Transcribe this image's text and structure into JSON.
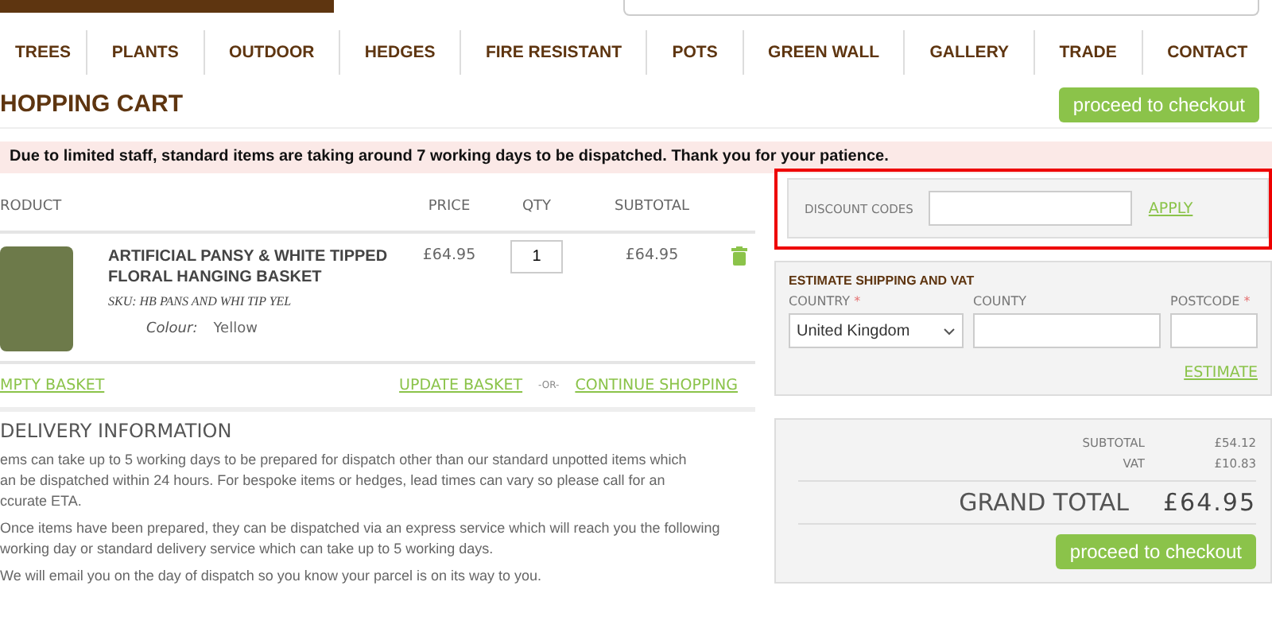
{
  "nav": [
    "TREES",
    "PLANTS",
    "OUTDOOR",
    "HEDGES",
    "FIRE RESISTANT",
    "POTS",
    "GREEN WALL",
    "GALLERY",
    "TRADE",
    "CONTACT"
  ],
  "title": "HOPPING CART",
  "checkout_top": "proceed to checkout",
  "notice": "Due to limited staff, standard items are taking around 7 working days to be dispatched. Thank you for your patience.",
  "cart": {
    "columns": [
      "RODUCT",
      "PRICE",
      "QTY",
      "SUBTOTAL"
    ],
    "items": [
      {
        "name": "ARTIFICIAL PANSY & WHITE TIPPED FLORAL HANGING BASKET",
        "sku": "SKU: HB PANS AND WHI TIP YEL",
        "option_label": "Colour:",
        "option_value": "Yellow",
        "price": "£64.95",
        "qty": "1",
        "subtotal": "£64.95"
      }
    ],
    "empty": "MPTY BASKET",
    "update": "UPDATE BASKET",
    "or": "-OR-",
    "continue": "CONTINUE SHOPPING"
  },
  "delivery": {
    "title": "DELIVERY INFORMATION",
    "paragraphs": [
      [
        "ems can take up to 5 working days to be prepared for dispatch other than our standard unpotted items which",
        "an be dispatched within 24 hours. For bespoke items or hedges, lead times can vary so please call for an",
        "ccurate ETA."
      ],
      [
        "Once items have been prepared, they can be dispatched via an express service which will reach you the following",
        "working day or standard delivery service which can take up to 5 working days."
      ],
      [
        "We will email you on the day of dispatch so you know your parcel is on its way to you."
      ]
    ]
  },
  "discount": {
    "label": "DISCOUNT CODES",
    "apply": "APPLY"
  },
  "shipping": {
    "title": "ESTIMATE SHIPPING AND VAT",
    "fields": [
      {
        "label": "COUNTRY",
        "marker": "*",
        "kind": "select",
        "value": "United Kingdom"
      },
      {
        "label": "COUNTY",
        "kind": "text"
      },
      {
        "label": "POSTCODE",
        "marker": "*",
        "kind": "text"
      }
    ],
    "estimate": "ESTIMATE"
  },
  "totals": {
    "rows": [
      {
        "label": "SUBTOTAL",
        "value": "£54.12"
      },
      {
        "label": "VAT",
        "value": "£10.83"
      }
    ],
    "grand_label": "GRAND TOTAL",
    "grand_value": "£64.95",
    "checkout": "proceed to checkout"
  }
}
